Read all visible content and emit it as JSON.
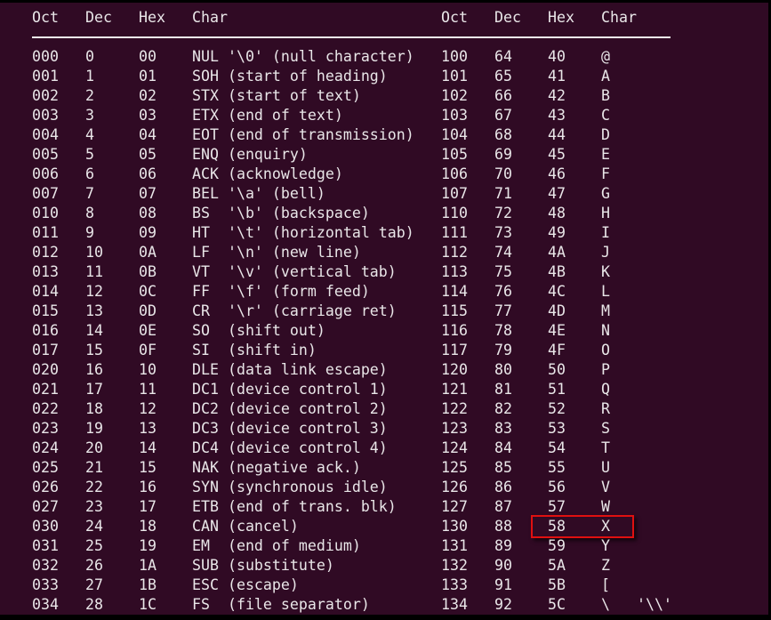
{
  "headers": [
    "Oct",
    "Dec",
    "Hex",
    "Char",
    "Oct",
    "Dec",
    "Hex",
    "Char"
  ],
  "highlight_color": "#e01010",
  "highlighted_row": {
    "oct": "130",
    "dec": "88",
    "hex": "58",
    "char": "X"
  },
  "rows": [
    [
      "000",
      "0",
      "00",
      "NUL '\\0' (null character)",
      "100",
      "64",
      "40",
      "@"
    ],
    [
      "001",
      "1",
      "01",
      "SOH (start of heading)",
      "101",
      "65",
      "41",
      "A"
    ],
    [
      "002",
      "2",
      "02",
      "STX (start of text)",
      "102",
      "66",
      "42",
      "B"
    ],
    [
      "003",
      "3",
      "03",
      "ETX (end of text)",
      "103",
      "67",
      "43",
      "C"
    ],
    [
      "004",
      "4",
      "04",
      "EOT (end of transmission)",
      "104",
      "68",
      "44",
      "D"
    ],
    [
      "005",
      "5",
      "05",
      "ENQ (enquiry)",
      "105",
      "69",
      "45",
      "E"
    ],
    [
      "006",
      "6",
      "06",
      "ACK (acknowledge)",
      "106",
      "70",
      "46",
      "F"
    ],
    [
      "007",
      "7",
      "07",
      "BEL '\\a' (bell)",
      "107",
      "71",
      "47",
      "G"
    ],
    [
      "010",
      "8",
      "08",
      "BS  '\\b' (backspace)",
      "110",
      "72",
      "48",
      "H"
    ],
    [
      "011",
      "9",
      "09",
      "HT  '\\t' (horizontal tab)",
      "111",
      "73",
      "49",
      "I"
    ],
    [
      "012",
      "10",
      "0A",
      "LF  '\\n' (new line)",
      "112",
      "74",
      "4A",
      "J"
    ],
    [
      "013",
      "11",
      "0B",
      "VT  '\\v' (vertical tab)",
      "113",
      "75",
      "4B",
      "K"
    ],
    [
      "014",
      "12",
      "0C",
      "FF  '\\f' (form feed)",
      "114",
      "76",
      "4C",
      "L"
    ],
    [
      "015",
      "13",
      "0D",
      "CR  '\\r' (carriage ret)",
      "115",
      "77",
      "4D",
      "M"
    ],
    [
      "016",
      "14",
      "0E",
      "SO  (shift out)",
      "116",
      "78",
      "4E",
      "N"
    ],
    [
      "017",
      "15",
      "0F",
      "SI  (shift in)",
      "117",
      "79",
      "4F",
      "O"
    ],
    [
      "020",
      "16",
      "10",
      "DLE (data link escape)",
      "120",
      "80",
      "50",
      "P"
    ],
    [
      "021",
      "17",
      "11",
      "DC1 (device control 1)",
      "121",
      "81",
      "51",
      "Q"
    ],
    [
      "022",
      "18",
      "12",
      "DC2 (device control 2)",
      "122",
      "82",
      "52",
      "R"
    ],
    [
      "023",
      "19",
      "13",
      "DC3 (device control 3)",
      "123",
      "83",
      "53",
      "S"
    ],
    [
      "024",
      "20",
      "14",
      "DC4 (device control 4)",
      "124",
      "84",
      "54",
      "T"
    ],
    [
      "025",
      "21",
      "15",
      "NAK (negative ack.)",
      "125",
      "85",
      "55",
      "U"
    ],
    [
      "026",
      "22",
      "16",
      "SYN (synchronous idle)",
      "126",
      "86",
      "56",
      "V"
    ],
    [
      "027",
      "23",
      "17",
      "ETB (end of trans. blk)",
      "127",
      "87",
      "57",
      "W"
    ],
    [
      "030",
      "24",
      "18",
      "CAN (cancel)",
      "130",
      "88",
      "58",
      "X"
    ],
    [
      "031",
      "25",
      "19",
      "EM  (end of medium)",
      "131",
      "89",
      "59",
      "Y"
    ],
    [
      "032",
      "26",
      "1A",
      "SUB (substitute)",
      "132",
      "90",
      "5A",
      "Z"
    ],
    [
      "033",
      "27",
      "1B",
      "ESC (escape)",
      "133",
      "91",
      "5B",
      "["
    ],
    [
      "034",
      "28",
      "1C",
      "FS  (file separator)",
      "134",
      "92",
      "5C",
      "\\   '\\\\'"
    ]
  ]
}
